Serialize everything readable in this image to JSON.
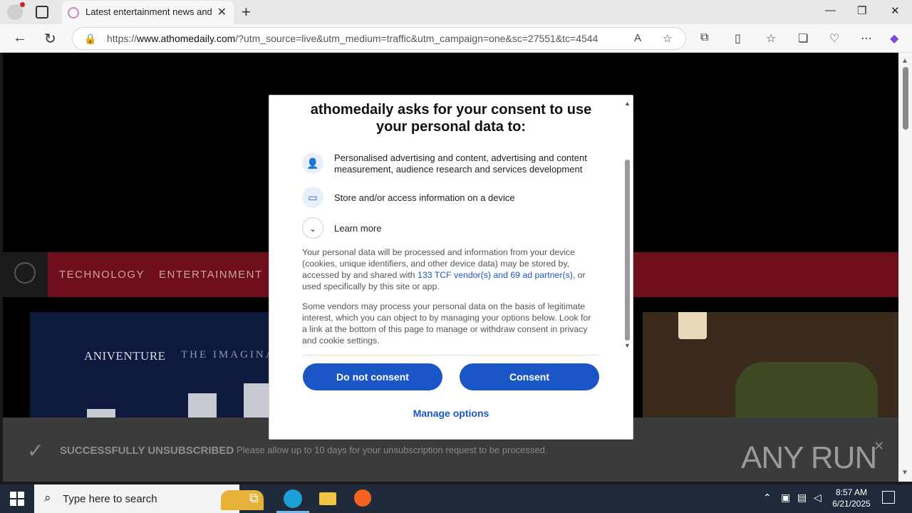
{
  "browser": {
    "tab_title": "Latest entertainment news and re",
    "url_prefix": "https://",
    "url_domain": "www.athomedaily.com",
    "url_rest": "/?utm_source=live&utm_medium=traffic&utm_campaign=one&sc=27551&tc=4544"
  },
  "site": {
    "nav": [
      "TECHNOLOGY",
      "ENTERTAINMENT"
    ],
    "hero_brand": "ANIVENTURE",
    "hero_brand2": "THE IMAGINA",
    "unsub_title": "SUCCESSFULLY UNSUBSCRIBED",
    "unsub_message": "Please allow up to 10 days for your unsubscription request to be processed.",
    "watermark": "ANY RUN"
  },
  "consent": {
    "title": "athomedaily asks for your consent to use your personal data to:",
    "purposes": [
      {
        "icon": "person-icon",
        "text": "Personalised advertising and content, advertising and content measurement, audience research and services development"
      },
      {
        "icon": "device-icon",
        "text": "Store and/or access information on a device"
      }
    ],
    "learn_more": "Learn more",
    "para1_a": "Your personal data will be processed and information from your device (cookies, unique identifiers, and other device data) may be stored by, accessed by and shared with ",
    "para1_link": "133 TCF vendor(s) and 69 ad partner(s)",
    "para1_b": ", or used specifically by this site or app.",
    "para2": "Some vendors may process your personal data on the basis of legitimate interest, which you can object to by managing your options below. Look for a link at the bottom of this page to manage or withdraw consent in privacy and cookie settings.",
    "do_not_consent": "Do not consent",
    "consent": "Consent",
    "manage_options": "Manage options",
    "accent": "#1a56c5"
  },
  "taskbar": {
    "search_placeholder": "Type here to search",
    "time": "8:57 AM",
    "date": "6/21/2025"
  }
}
